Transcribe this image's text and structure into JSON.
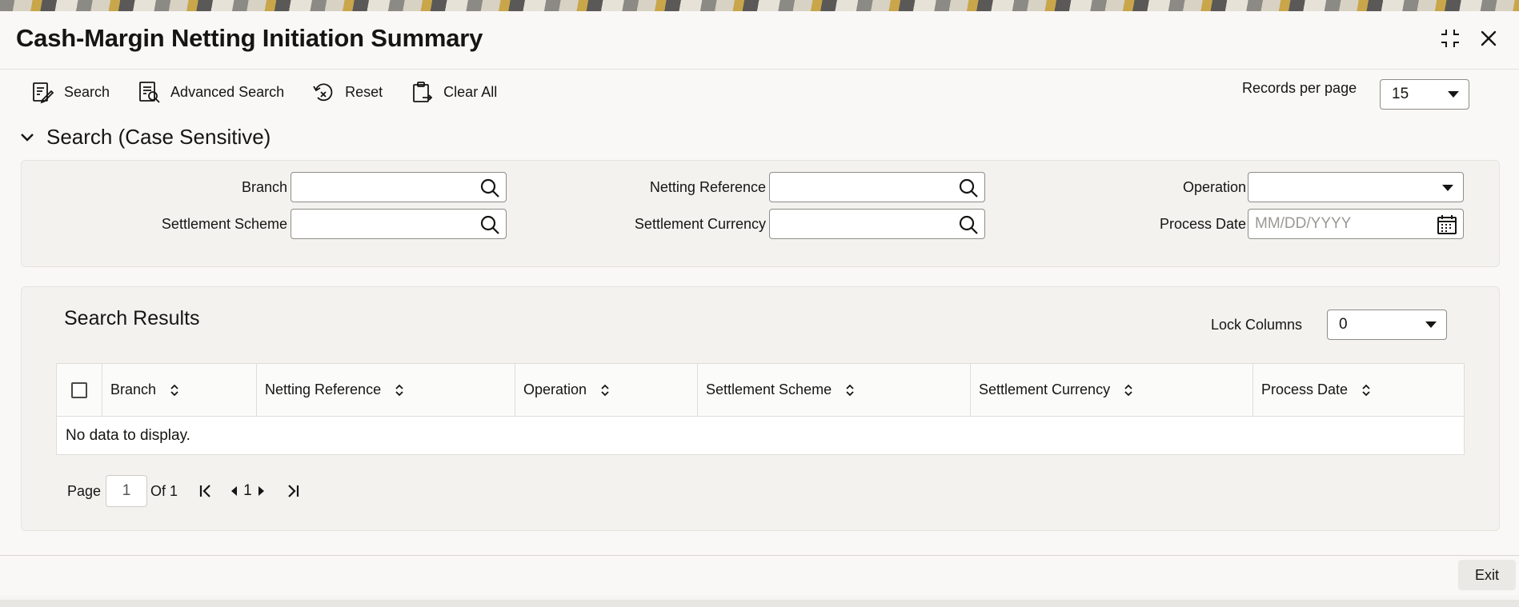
{
  "window": {
    "title": "Cash-Margin Netting Initiation Summary"
  },
  "toolbar": {
    "search_label": "Search",
    "advanced_search_label": "Advanced Search",
    "reset_label": "Reset",
    "clear_all_label": "Clear All",
    "records_per_page_label": "Records per page",
    "records_per_page_value": "15"
  },
  "search_section": {
    "header": "Search (Case Sensitive)",
    "fields": {
      "branch": {
        "label": "Branch",
        "value": ""
      },
      "netting_reference": {
        "label": "Netting Reference",
        "value": ""
      },
      "operation": {
        "label": "Operation",
        "value": ""
      },
      "settlement_scheme": {
        "label": "Settlement Scheme",
        "value": ""
      },
      "settlement_currency": {
        "label": "Settlement Currency",
        "value": ""
      },
      "process_date": {
        "label": "Process Date",
        "placeholder": "MM/DD/YYYY"
      }
    }
  },
  "results": {
    "title": "Search Results",
    "lock_columns_label": "Lock Columns",
    "lock_columns_value": "0",
    "columns": [
      "Branch",
      "Netting Reference",
      "Operation",
      "Settlement Scheme",
      "Settlement Currency",
      "Process Date"
    ],
    "empty_message": "No data to display."
  },
  "pager": {
    "page_label": "Page",
    "current_page": "1",
    "of_label": "Of 1",
    "page_number": "1"
  },
  "footer": {
    "exit_label": "Exit"
  }
}
